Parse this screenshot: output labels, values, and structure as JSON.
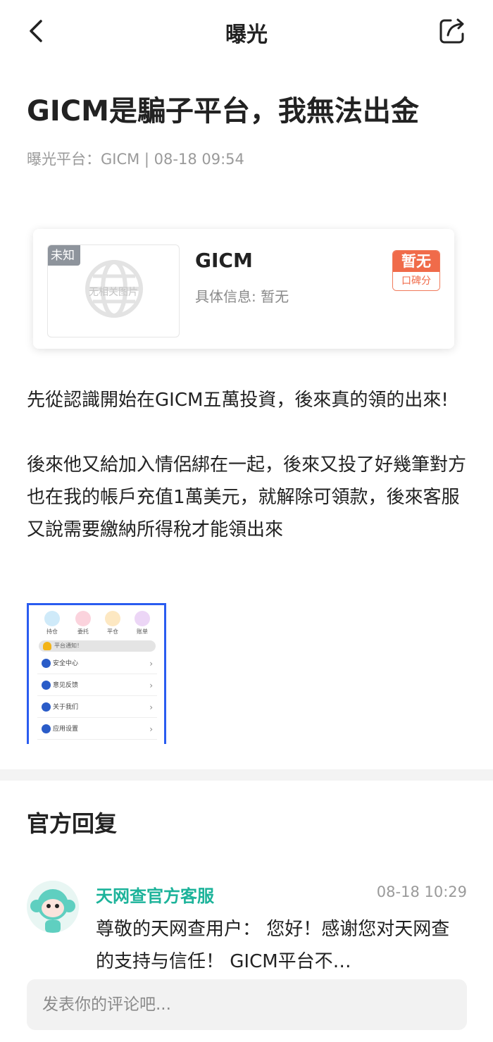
{
  "nav": {
    "title": "曝光",
    "back_icon": "chevron-left-icon",
    "share_icon": "share-icon"
  },
  "article": {
    "title": "GICM是騙子平台，我無法出金",
    "meta": "曝光平台：GICM | 08-18 09:54"
  },
  "card": {
    "tag": "未知",
    "no_image_text": "无相关图片",
    "name": "GICM",
    "info": "具体信息: 暂无",
    "rating_value": "暂无",
    "rating_label": "口碑分",
    "rating_color": "#f06b4a"
  },
  "body": {
    "paragraphs": [
      "先從認識開始在GICM五萬投資，後來真的領的出來!",
      "後來他又給加入情侶綁在一起，後來又投了好幾筆對方也在我的帳戶充值1萬美元，就解除可領款，後來客服又說需要繳納所得稅才能領出來"
    ]
  },
  "screenshot": {
    "icons": [
      {
        "label": "持仓",
        "color": "#58b7f2"
      },
      {
        "label": "委托",
        "color": "#f06b8c"
      },
      {
        "label": "平仓",
        "color": "#f5b841"
      },
      {
        "label": "账单",
        "color": "#a65ad6"
      }
    ],
    "notice": "平台通知！",
    "rows": [
      "安全中心",
      "意见反馈",
      "关于我们",
      "应用设置"
    ]
  },
  "reply_section": {
    "title": "官方回复",
    "author": "天网查官方客服",
    "time": "08-18 10:29",
    "text": "尊敬的天网查用户： 您好！感谢您对天网查的支持与信任！ GICM平台不…",
    "author_color": "#1cb39a"
  },
  "comment": {
    "placeholder": "发表你的评论吧..."
  }
}
